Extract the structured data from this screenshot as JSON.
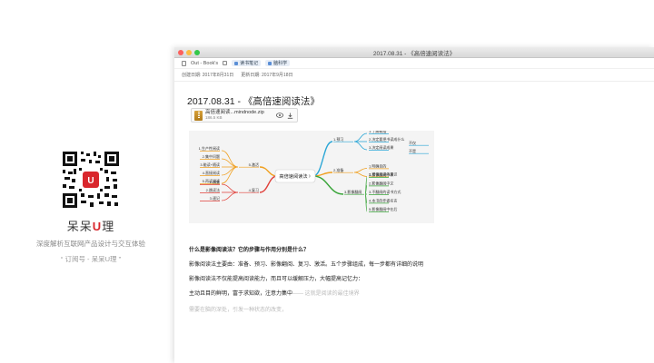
{
  "window": {
    "title": "2017.08.31 - 《高倍速阅读法》"
  },
  "toolbar": {
    "notebook": "Out - Book's",
    "tags": [
      "读书笔记",
      "脑科学"
    ]
  },
  "meta": {
    "created": "创建日期: 2017年8月31日",
    "updated": "更新日期: 2017年9月18日"
  },
  "note": {
    "title": "2017.08.31 - 《高倍速阅读法》"
  },
  "attachment": {
    "name": "高倍速阅读...mindnode.zip",
    "size": "186.5 KB",
    "view_icon": "eye-icon",
    "download_icon": "download-icon"
  },
  "mindmap": {
    "center": "高倍速阅读法",
    "colors": {
      "blue": "#2aa6d6",
      "green": "#3aa53a",
      "orange": "#f0a020",
      "red": "#e0403a"
    },
    "branches": {
      "b1": {
        "label": "1.预习",
        "children": [
          "1.了解概括",
          "2.决定要把书读成什么",
          "3.决定阅读成果"
        ],
        "extra": [
          "不仅",
          "不是"
        ]
      },
      "b2": {
        "label": "2.准备",
        "children": [
          "1.明确目的",
          "2.增强阅读的意识"
        ]
      },
      "b3": {
        "label": "3.影像翻阅",
        "children": [
          "1.影像翻阅中表",
          "2.影像翻阅中文",
          "3.不翻阅的读书方式",
          "4.本书的作者名言",
          "5.影像翻阅中在后"
        ]
      },
      "b4": {
        "label": "5.激活",
        "children": [
          "1.生产性阅读",
          "2.集中问题",
          "3.能读+随读",
          "4.直接阅读",
          "5.再读阅读"
        ]
      },
      "b5": {
        "label": "4.复习",
        "children": [
          "1.调查",
          "2.跳读法",
          "3.速记"
        ]
      }
    }
  },
  "qa": {
    "q1": "什么是影像阅读法？它的步骤与作用分别是什么？",
    "a1": "影像阅读法主要由：准备、预习、影像翻阅、复习、激活。五个步骤组成，每一步都有详细的说明",
    "a2": "影像阅读法不仅能提高阅读能力，而且可以缓解压力，大幅提高记忆力：",
    "a3": "主动且目的鲜明，富于求知欲，注意力集中",
    "a3_fade": "—— 这就是阅读的最佳境界",
    "a4": "需要在脑的深处，引发一种状态的改变，"
  },
  "promo": {
    "logo_icon": "qr-code-icon",
    "title_prefix": "呆呆",
    "title_accent": "U",
    "title_suffix": "理",
    "subtitle": "深度解析互联网产品设计与交互体验",
    "signature": "“ 订阅号 - 呆呆U理 ”"
  }
}
